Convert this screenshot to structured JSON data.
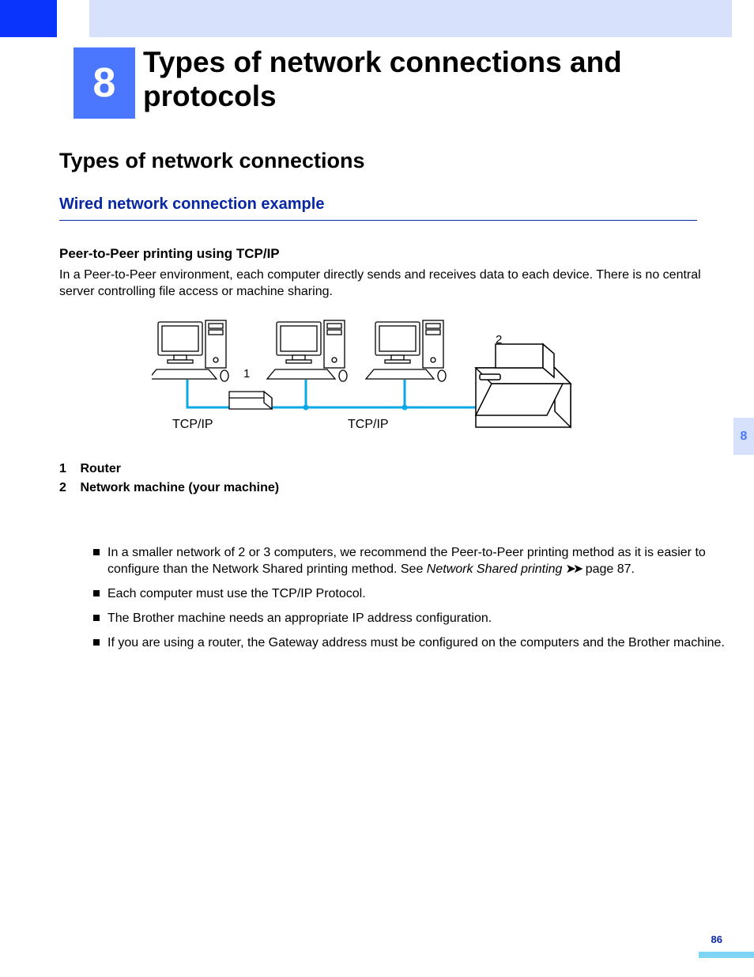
{
  "chapter": {
    "number": "8",
    "title": "Types of network connections and protocols"
  },
  "h1": "Types of network connections",
  "h2": "Wired network connection example",
  "h3": "Peer-to-Peer printing using TCP/IP",
  "intro": "In a Peer-to-Peer environment, each computer directly sends and receives data to each device. There is no central server controlling file access or machine sharing.",
  "diagram": {
    "callout1": "1",
    "callout2": "2",
    "tcpip": "TCP/IP"
  },
  "legend": [
    {
      "num": "1",
      "text": "Router"
    },
    {
      "num": "2",
      "text": "Network machine (your machine)"
    }
  ],
  "bullets": [
    {
      "pre": "In a smaller network of 2 or 3 computers, we recommend the Peer-to-Peer printing method as it is easier to configure than the Network Shared printing method. See ",
      "ref": "Network Shared printing",
      "post": " page 87."
    },
    {
      "pre": "Each computer must use the TCP/IP Protocol."
    },
    {
      "pre": "The Brother machine needs an appropriate IP address configuration."
    },
    {
      "pre": "If you are using a router, the Gateway address must be configured on the computers and the Brother machine."
    }
  ],
  "side_tab": "8",
  "page_number": "86",
  "arrows": "➤➤"
}
